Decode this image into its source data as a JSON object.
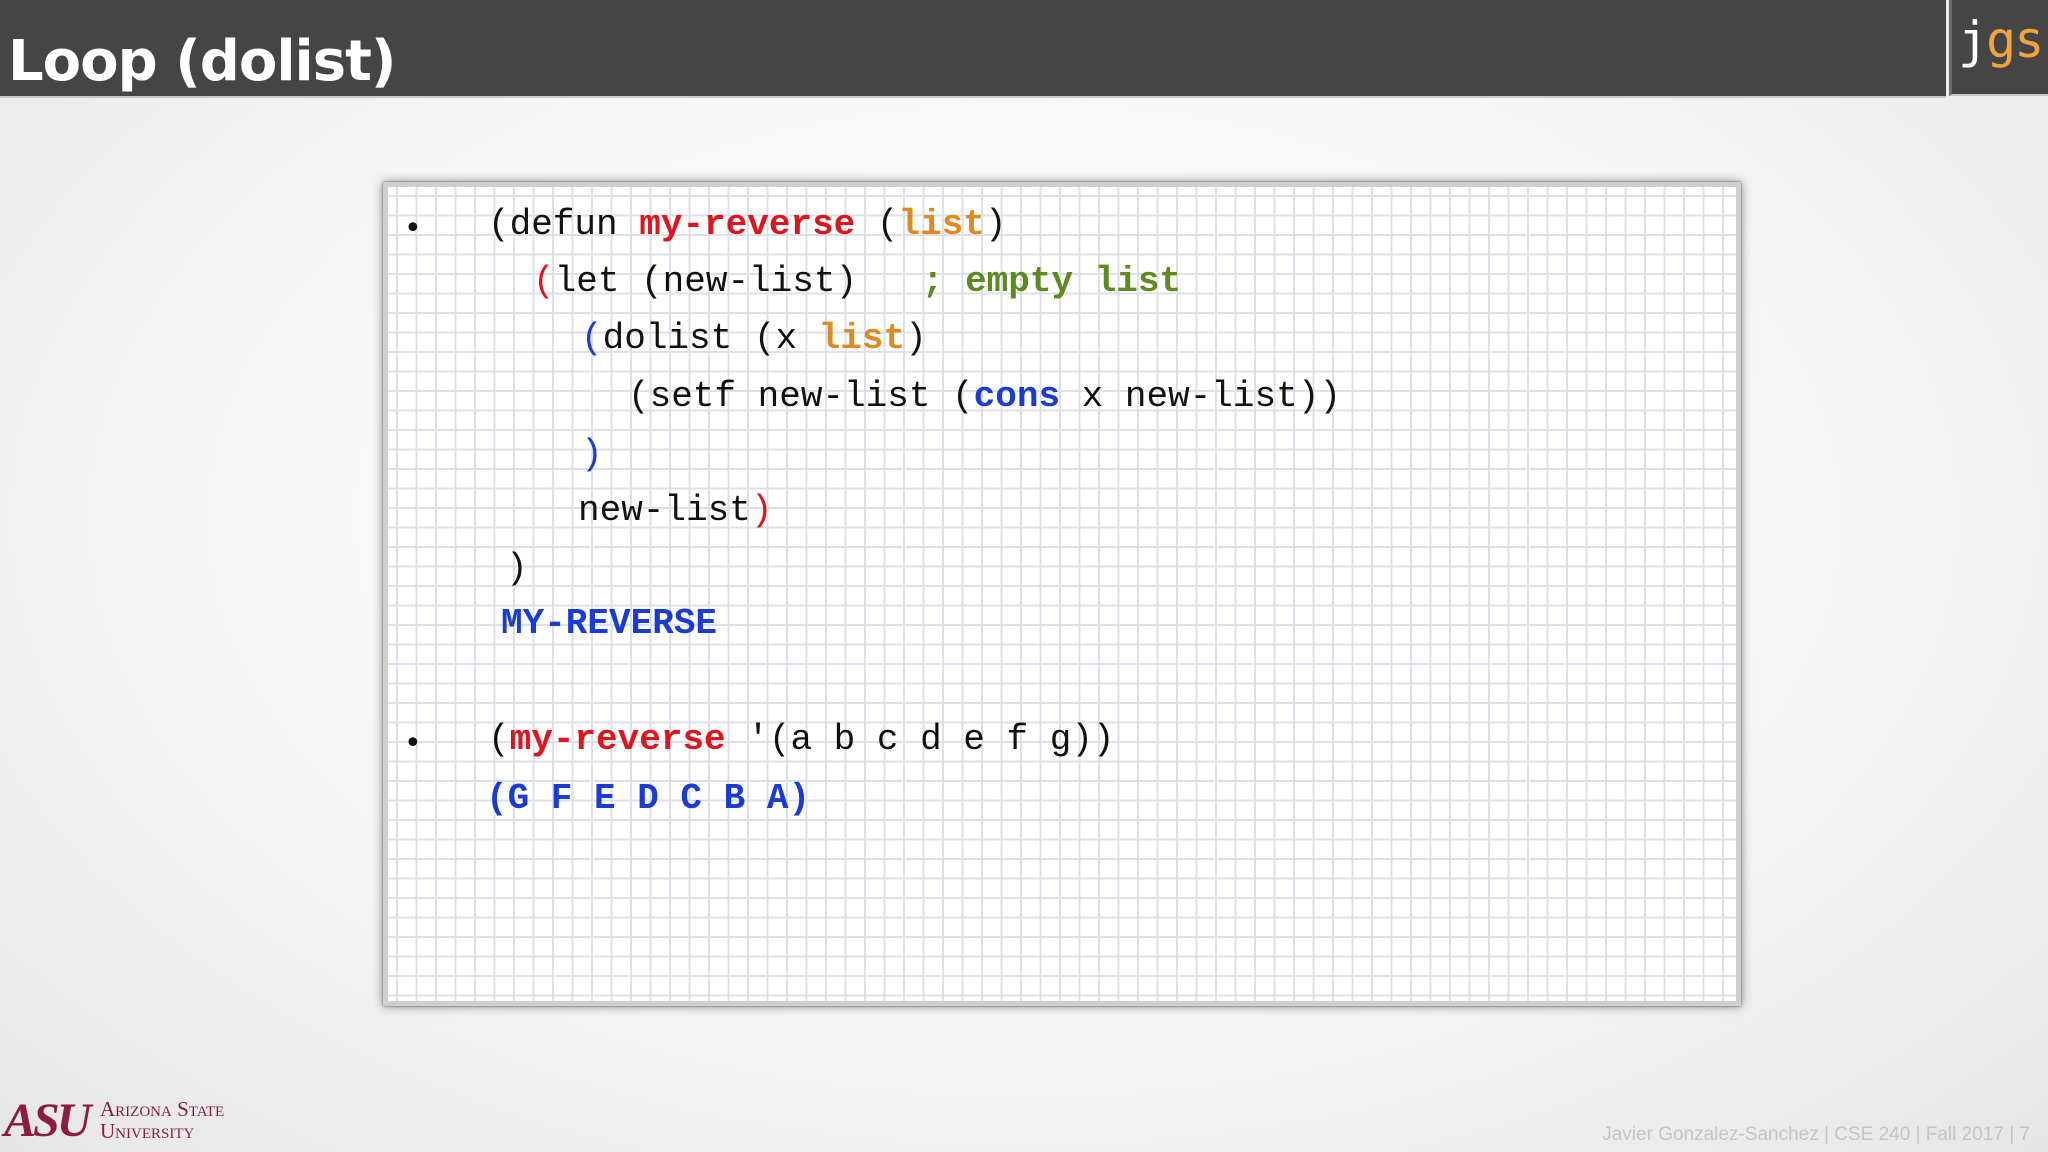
{
  "header": {
    "title": "Loop (dolist)",
    "logo_part1": "j",
    "logo_part2": "gs"
  },
  "code": {
    "bullet": "•",
    "line1": {
      "pre": "(defun ",
      "fname": "my-reverse",
      "mid": " (",
      "param": "list",
      "post": ")"
    },
    "line2": {
      "open": "(",
      "body": "let (new-list)   ",
      "comment": "; empty list"
    },
    "line3": {
      "open": "(",
      "body": "dolist (x ",
      "param": "list",
      "post": ")"
    },
    "line4": {
      "pre": "(setf new-list (",
      "fn": "cons",
      "post": " x new-list))"
    },
    "line5": ")",
    "line6": {
      "body": "new-list",
      "close": ")"
    },
    "line7": ")",
    "line8": "MY-REVERSE",
    "line9": {
      "pre": "(",
      "fname": "my-reverse",
      "post": " '(a b c d e f g))"
    },
    "line10": "(G F E D C B A)"
  },
  "branding": {
    "asu_mark": "ASU",
    "asu_line1": "Arizona State",
    "asu_line2": "University"
  },
  "footer": {
    "text": "Javier Gonzalez-Sanchez | CSE 240 | Fall 2017 | 7"
  },
  "colors": {
    "header_bg": "#454545",
    "function_name": "#e0141c",
    "parameter": "#e08a1e",
    "comment": "#5f8a20",
    "builtin_and_output": "#1a3bd6",
    "asu_maroon": "#8c1d40"
  }
}
